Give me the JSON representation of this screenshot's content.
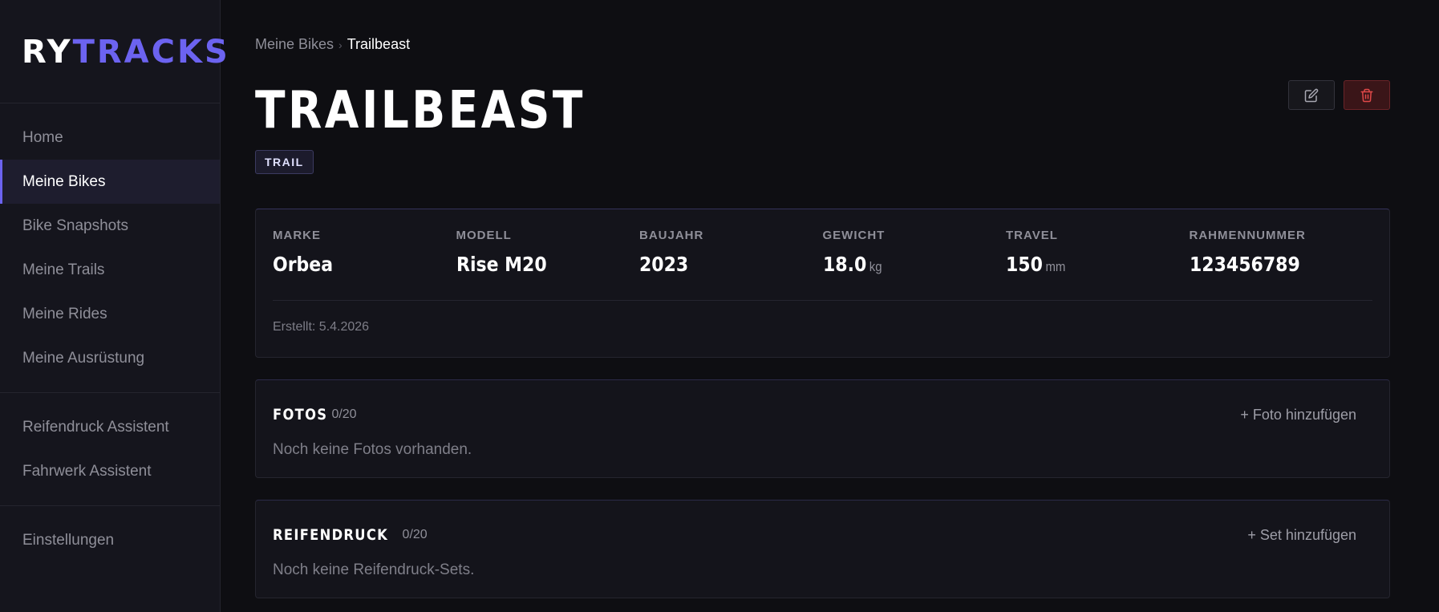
{
  "logo": {
    "part1": "RY",
    "part2": "TRACKS"
  },
  "sidebar": {
    "groups": [
      [
        {
          "label": "Home",
          "active": false
        },
        {
          "label": "Meine Bikes",
          "active": true
        },
        {
          "label": "Bike Snapshots",
          "active": false
        },
        {
          "label": "Meine Trails",
          "active": false
        },
        {
          "label": "Meine Rides",
          "active": false
        },
        {
          "label": "Meine Ausrüstung",
          "active": false
        }
      ],
      [
        {
          "label": "Reifendruck Assistent",
          "active": false
        },
        {
          "label": "Fahrwerk Assistent",
          "active": false
        }
      ],
      [
        {
          "label": "Einstellungen",
          "active": false
        }
      ]
    ]
  },
  "breadcrumb": {
    "parent": "Meine Bikes",
    "separator": "›",
    "current": "Trailbeast"
  },
  "page": {
    "title": "TRAILBEAST",
    "badge": "TRAIL"
  },
  "actions": {
    "edit_icon": "edit-icon",
    "delete_icon": "trash-icon"
  },
  "info": {
    "fields": [
      {
        "label": "MARKE",
        "value": "Orbea",
        "unit": ""
      },
      {
        "label": "MODELL",
        "value": "Rise M20",
        "unit": ""
      },
      {
        "label": "BAUJAHR",
        "value": "2023",
        "unit": ""
      },
      {
        "label": "GEWICHT",
        "value": "18.0",
        "unit": "kg"
      },
      {
        "label": "TRAVEL",
        "value": "150",
        "unit": "mm"
      },
      {
        "label": "RAHMENNUMMER",
        "value": "123456789",
        "unit": ""
      }
    ],
    "created": "Erstellt: 5.4.2026"
  },
  "fotos": {
    "title": "FOTOS",
    "count": "0/20",
    "add": "+ Foto hinzufügen",
    "empty": "Noch keine Fotos vorhanden."
  },
  "reifendruck": {
    "title": "REIFENDRUCK",
    "count": "0/20",
    "add": "+ Set hinzufügen",
    "empty": "Noch keine Reifendruck-Sets."
  },
  "colors": {
    "accent": "#6c63f0",
    "background": "#0e0e12",
    "sidebar": "#15151d",
    "danger": "#e04848"
  }
}
